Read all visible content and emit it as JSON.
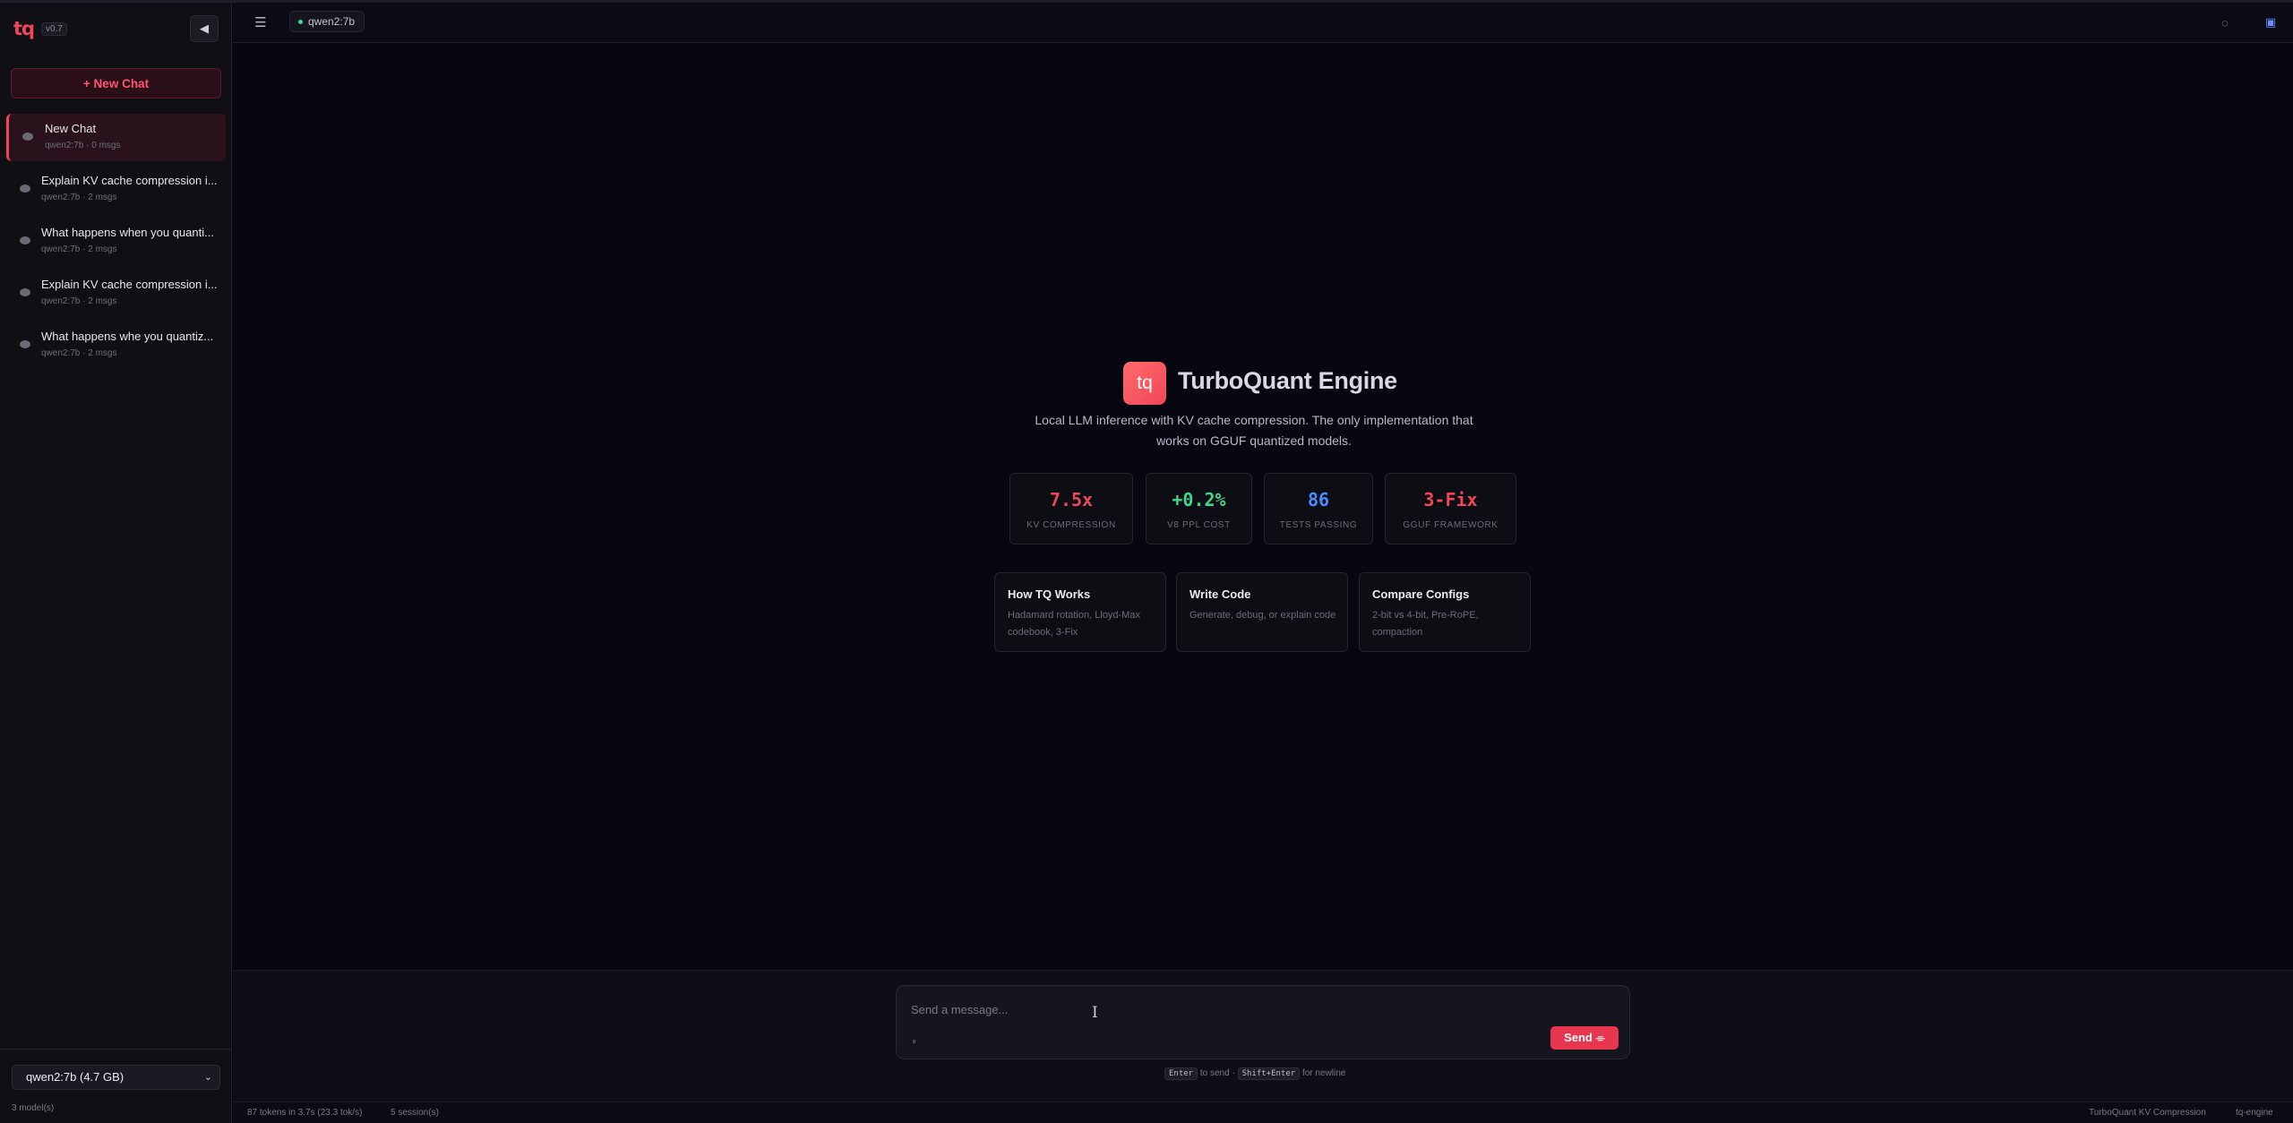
{
  "sidebar": {
    "logo": "tq",
    "version": "v0.7",
    "collapse_icon": "◀",
    "new_chat_label": "+ New Chat",
    "sessions": [
      {
        "title": "New Chat",
        "meta": "qwen2:7b · 0 msgs",
        "active": true
      },
      {
        "title": "Explain KV cache compression i...",
        "meta": "qwen2:7b · 2 msgs"
      },
      {
        "title": "What happens when you quanti...",
        "meta": "qwen2:7b · 2 msgs"
      },
      {
        "title": "Explain KV cache compression i...",
        "meta": "qwen2:7b · 2 msgs"
      },
      {
        "title": "What happens whe you quantiz...",
        "meta": "qwen2:7b · 2 msgs"
      }
    ],
    "model_select": "qwen2:7b (4.7 GB)",
    "models_count": "3 model(s)"
  },
  "topbar": {
    "menu_icon": "☰",
    "model": "qwen2:7b",
    "status_color": "#3dd68c",
    "theme_icon": "◌",
    "settings_icon": "▣"
  },
  "welcome": {
    "logo_text": "tq",
    "title": "TurboQuant Engine",
    "tagline": "Local LLM inference with KV cache compression. The only implementation that works on GGUF quantized models.",
    "stats": [
      {
        "value": "7.5x",
        "label": "KV COMPRESSION",
        "color": "#f0465a"
      },
      {
        "value": "+0.2%",
        "label": "V8 PPL COST",
        "color": "#3dd68c"
      },
      {
        "value": "86",
        "label": "TESTS PASSING",
        "color": "#4a8cff"
      },
      {
        "value": "3-Fix",
        "label": "GGUF FRAMEWORK",
        "color": "#f0465a"
      }
    ],
    "cards": [
      {
        "title": "How TQ Works",
        "desc": "Hadamard rotation, Lloyd-Max codebook, 3-Fix"
      },
      {
        "title": "Write Code",
        "desc": "Generate, debug, or explain code"
      },
      {
        "title": "Compare Configs",
        "desc": "2-bit vs 4-bit, Pre-RoPE, compaction"
      }
    ]
  },
  "composer": {
    "placeholder": "Send a message...",
    "attach_icon": "⏸",
    "send_label": "Send ⌯",
    "hint_enter": "Enter",
    "hint_to_send": "to send ·",
    "hint_shift": "Shift+Enter",
    "hint_newline": "for newline"
  },
  "statusbar": {
    "tokens": "87 tokens in 3.7s (23.3 tok/s)",
    "sessions": "5 session(s)",
    "product": "TurboQuant KV Compression",
    "engine": "tq-engine"
  },
  "accent": "#f0465a"
}
